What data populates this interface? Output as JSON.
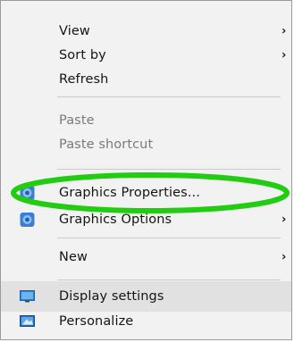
{
  "menu": {
    "view_label": "View",
    "sort_by_label": "Sort by",
    "refresh_label": "Refresh",
    "paste_label": "Paste",
    "paste_shortcut_label": "Paste shortcut",
    "graphics_properties_label": "Graphics Properties...",
    "graphics_options_label": "Graphics Options",
    "new_label": "New",
    "display_settings_label": "Display settings",
    "personalize_label": "Personalize",
    "submenu_arrow": "›"
  },
  "colors": {
    "annotation_ring": "#22cc11",
    "menu_background": "#f2f2f2",
    "hover_background": "#e1e1e1"
  },
  "icons": {
    "graphics_properties": "intel-graphics-icon",
    "graphics_options": "intel-graphics-icon",
    "display_settings": "display-icon",
    "personalize": "personalize-icon"
  }
}
